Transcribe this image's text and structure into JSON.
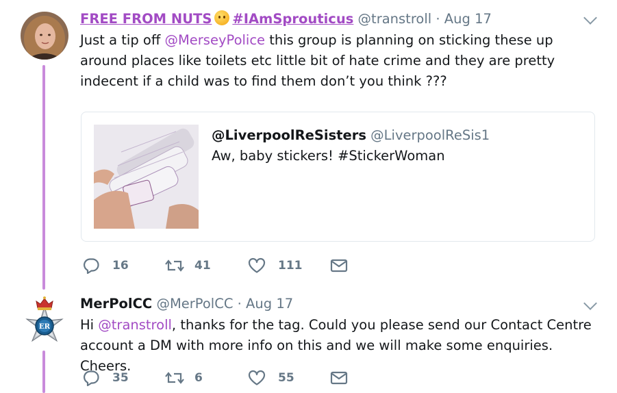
{
  "tweets": [
    {
      "display_name": "FREE FROM NUTS",
      "display_name_hashtag": "#IAmSprouticus",
      "handle": "@transtroll",
      "separator": "·",
      "date": "Aug 17",
      "text_before": "Just a tip off ",
      "mention": "@MerseyPolice",
      "text_after": " this group is planning on sticking these up around places like toilets etc little bit of hate crime and they are pretty indecent if a child was to find them don’t you think ???",
      "quoted": {
        "display_name": "@LiverpoolReSisters",
        "handle": "@LiverpoolReSis1",
        "text": "Aw, baby stickers! #StickerWoman"
      },
      "actions": {
        "replies": "16",
        "retweets": "41",
        "likes": "111"
      }
    },
    {
      "display_name": "MerPolCC",
      "handle": "@MerPolCC",
      "separator": "·",
      "date": "Aug 17",
      "text_before": "Hi ",
      "mention": "@transtroll",
      "text_after": ", thanks for the tag. Could you please send our Contact Centre account a DM with more info on this and we will make some enquiries. Cheers.",
      "actions": {
        "replies": "35",
        "retweets": "6",
        "likes": "55"
      }
    }
  ],
  "colors": {
    "accent": "#a24bc4",
    "thread_line": "#c98bdb",
    "muted": "#657786"
  },
  "icons": [
    "reply-icon",
    "retweet-icon",
    "like-icon",
    "dm-icon",
    "chevron-down-icon",
    "hugging-face-emoji",
    "police-badge-avatar"
  ]
}
